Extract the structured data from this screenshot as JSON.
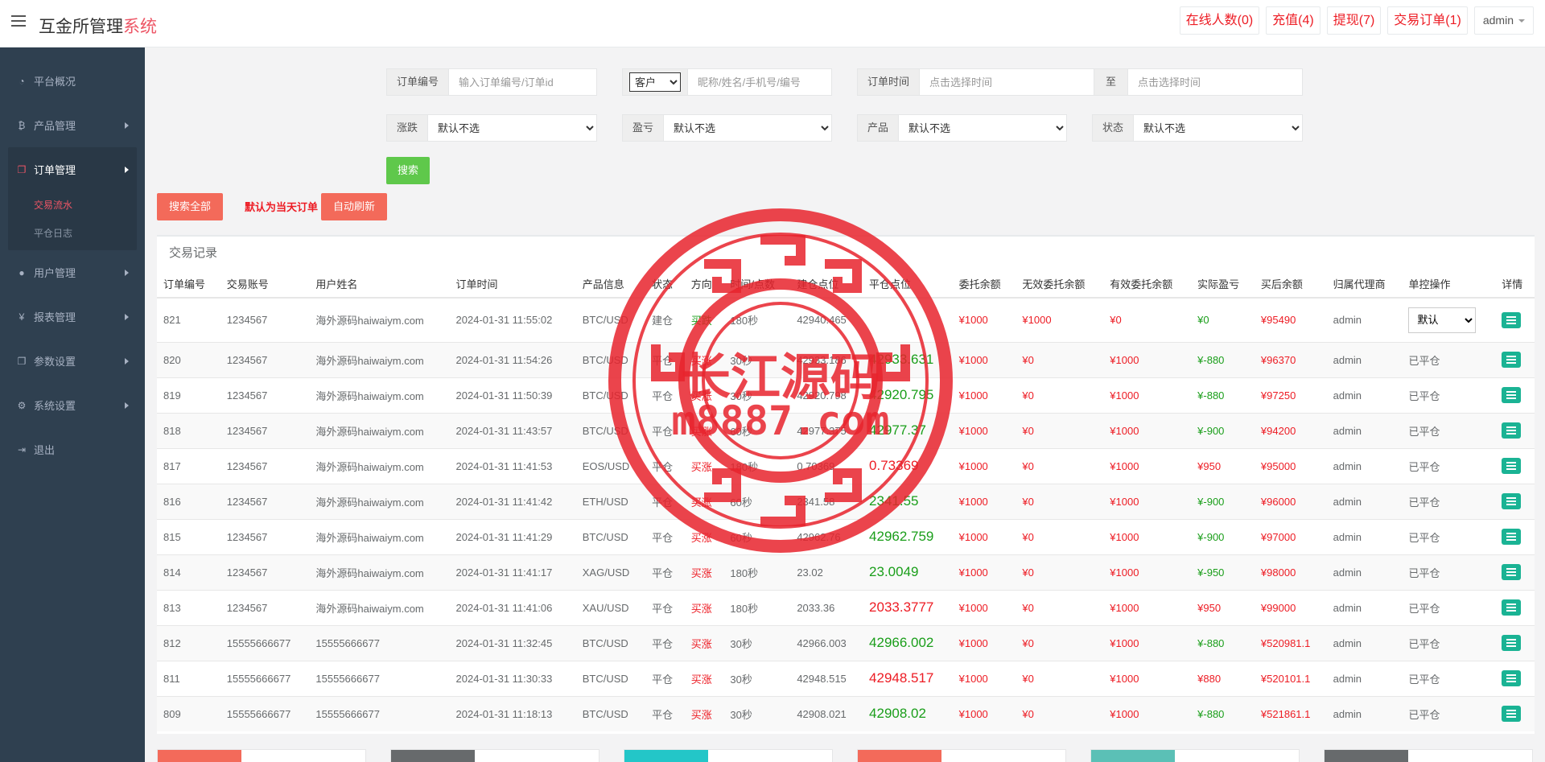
{
  "header": {
    "title_main": "互金所管理",
    "title_accent": "系统",
    "buttons": [
      "在线人数(0)",
      "充值(4)",
      "提现(7)",
      "交易订单(1)"
    ],
    "user": "admin"
  },
  "sidebar": {
    "items": [
      {
        "label": "平台概况",
        "icon": "dashboard-icon"
      },
      {
        "label": "产品管理",
        "icon": "bitcoin-icon"
      },
      {
        "label": "订单管理",
        "icon": "copy-icon"
      },
      {
        "label": "用户管理",
        "icon": "user-icon"
      },
      {
        "label": "报表管理",
        "icon": "yen-icon"
      },
      {
        "label": "参数设置",
        "icon": "copy-icon"
      },
      {
        "label": "系统设置",
        "icon": "cogs-icon"
      },
      {
        "label": "退出",
        "icon": "signout-icon"
      }
    ],
    "subitems": [
      "交易流水",
      "平仓日志"
    ]
  },
  "filters": {
    "order_no_label": "订单编号",
    "order_no_placeholder": "输入订单编号/订单id",
    "customer_select": "客户",
    "customer_placeholder": "昵称/姓名/手机号/编号",
    "order_time_label": "订单时间",
    "time_placeholder": "点击选择时间",
    "to_label": "至",
    "rise_label": "涨跌",
    "profit_label": "盈亏",
    "product_label": "产品",
    "status_label": "状态",
    "default_option": "默认不选",
    "search_btn": "搜索",
    "search_all_btn": "搜索全部",
    "default_note": "默认为当天订单",
    "auto_refresh_btn": "自动刷新"
  },
  "table": {
    "title": "交易记录",
    "columns": [
      "订单编号",
      "交易账号",
      "用户姓名",
      "订单时间",
      "产品信息",
      "状态",
      "方向",
      "时间/点数",
      "建仓点位",
      "平仓点位",
      "委托余额",
      "无效委托余额",
      "有效委托余额",
      "实际盈亏",
      "买后余额",
      "归属代理商",
      "单控操作",
      "详情"
    ],
    "rows": [
      {
        "id": "821",
        "account": "1234567",
        "name": "海外源码haiwaiym.com",
        "time": "2024-01-31 11:55:02",
        "product": "BTC/USD",
        "status": "建仓",
        "direction": "买跌",
        "dir_color": "green",
        "period": "180秒",
        "open": "42940.465",
        "close": "",
        "close_color": "",
        "entrust": "¥1000",
        "invalid": "¥1000",
        "valid": "¥0",
        "pnl": "¥0",
        "pnl_color": "green",
        "balance": "¥95490",
        "agent": "admin",
        "op": "默认",
        "op_select": true
      },
      {
        "id": "820",
        "account": "1234567",
        "name": "海外源码haiwaiym.com",
        "time": "2024-01-31 11:54:26",
        "product": "BTC/USD",
        "status": "平仓",
        "direction": "买涨",
        "dir_color": "red",
        "period": "30秒",
        "open": "42933.186",
        "close": "42933.631",
        "close_color": "green",
        "entrust": "¥1000",
        "invalid": "¥0",
        "valid": "¥1000",
        "pnl": "¥-880",
        "pnl_color": "green",
        "balance": "¥96370",
        "agent": "admin",
        "op": "已平仓",
        "op_select": false
      },
      {
        "id": "819",
        "account": "1234567",
        "name": "海外源码haiwaiym.com",
        "time": "2024-01-31 11:50:39",
        "product": "BTC/USD",
        "status": "平仓",
        "direction": "买涨",
        "dir_color": "red",
        "period": "30秒",
        "open": "42920.798",
        "close": "42920.795",
        "close_color": "green",
        "entrust": "¥1000",
        "invalid": "¥0",
        "valid": "¥1000",
        "pnl": "¥-880",
        "pnl_color": "green",
        "balance": "¥97250",
        "agent": "admin",
        "op": "已平仓",
        "op_select": false
      },
      {
        "id": "818",
        "account": "1234567",
        "name": "海外源码haiwaiym.com",
        "time": "2024-01-31 11:43:57",
        "product": "BTC/USD",
        "status": "平仓",
        "direction": "买涨",
        "dir_color": "red",
        "period": "60秒",
        "open": "42977.375",
        "close": "42977.37",
        "close_color": "green",
        "entrust": "¥1000",
        "invalid": "¥0",
        "valid": "¥1000",
        "pnl": "¥-900",
        "pnl_color": "green",
        "balance": "¥94200",
        "agent": "admin",
        "op": "已平仓",
        "op_select": false
      },
      {
        "id": "817",
        "account": "1234567",
        "name": "海外源码haiwaiym.com",
        "time": "2024-01-31 11:41:53",
        "product": "EOS/USD",
        "status": "平仓",
        "direction": "买涨",
        "dir_color": "red",
        "period": "180秒",
        "open": "0.70369",
        "close": "0.73369",
        "close_color": "red",
        "entrust": "¥1000",
        "invalid": "¥0",
        "valid": "¥1000",
        "pnl": "¥950",
        "pnl_color": "red",
        "balance": "¥95000",
        "agent": "admin",
        "op": "已平仓",
        "op_select": false
      },
      {
        "id": "816",
        "account": "1234567",
        "name": "海外源码haiwaiym.com",
        "time": "2024-01-31 11:41:42",
        "product": "ETH/USD",
        "status": "平仓",
        "direction": "买涨",
        "dir_color": "red",
        "period": "60秒",
        "open": "2341.58",
        "close": "2341.55",
        "close_color": "green",
        "entrust": "¥1000",
        "invalid": "¥0",
        "valid": "¥1000",
        "pnl": "¥-900",
        "pnl_color": "green",
        "balance": "¥96000",
        "agent": "admin",
        "op": "已平仓",
        "op_select": false
      },
      {
        "id": "815",
        "account": "1234567",
        "name": "海外源码haiwaiym.com",
        "time": "2024-01-31 11:41:29",
        "product": "BTC/USD",
        "status": "平仓",
        "direction": "买涨",
        "dir_color": "red",
        "period": "60秒",
        "open": "42962.76",
        "close": "42962.759",
        "close_color": "green",
        "entrust": "¥1000",
        "invalid": "¥0",
        "valid": "¥1000",
        "pnl": "¥-900",
        "pnl_color": "green",
        "balance": "¥97000",
        "agent": "admin",
        "op": "已平仓",
        "op_select": false
      },
      {
        "id": "814",
        "account": "1234567",
        "name": "海外源码haiwaiym.com",
        "time": "2024-01-31 11:41:17",
        "product": "XAG/USD",
        "status": "平仓",
        "direction": "买涨",
        "dir_color": "red",
        "period": "180秒",
        "open": "23.02",
        "close": "23.0049",
        "close_color": "green",
        "entrust": "¥1000",
        "invalid": "¥0",
        "valid": "¥1000",
        "pnl": "¥-950",
        "pnl_color": "green",
        "balance": "¥98000",
        "agent": "admin",
        "op": "已平仓",
        "op_select": false
      },
      {
        "id": "813",
        "account": "1234567",
        "name": "海外源码haiwaiym.com",
        "time": "2024-01-31 11:41:06",
        "product": "XAU/USD",
        "status": "平仓",
        "direction": "买涨",
        "dir_color": "red",
        "period": "180秒",
        "open": "2033.36",
        "close": "2033.3777",
        "close_color": "red",
        "entrust": "¥1000",
        "invalid": "¥0",
        "valid": "¥1000",
        "pnl": "¥950",
        "pnl_color": "red",
        "balance": "¥99000",
        "agent": "admin",
        "op": "已平仓",
        "op_select": false
      },
      {
        "id": "812",
        "account": "15555666677",
        "name": "15555666677",
        "time": "2024-01-31 11:32:45",
        "product": "BTC/USD",
        "status": "平仓",
        "direction": "买涨",
        "dir_color": "red",
        "period": "30秒",
        "open": "42966.003",
        "close": "42966.002",
        "close_color": "green",
        "entrust": "¥1000",
        "invalid": "¥0",
        "valid": "¥1000",
        "pnl": "¥-880",
        "pnl_color": "green",
        "balance": "¥520981.1",
        "agent": "admin",
        "op": "已平仓",
        "op_select": false
      },
      {
        "id": "811",
        "account": "15555666677",
        "name": "15555666677",
        "time": "2024-01-31 11:30:33",
        "product": "BTC/USD",
        "status": "平仓",
        "direction": "买涨",
        "dir_color": "red",
        "period": "30秒",
        "open": "42948.515",
        "close": "42948.517",
        "close_color": "red",
        "entrust": "¥1000",
        "invalid": "¥0",
        "valid": "¥1000",
        "pnl": "¥880",
        "pnl_color": "red",
        "balance": "¥520101.1",
        "agent": "admin",
        "op": "已平仓",
        "op_select": false
      },
      {
        "id": "809",
        "account": "15555666677",
        "name": "15555666677",
        "time": "2024-01-31 11:18:13",
        "product": "BTC/USD",
        "status": "平仓",
        "direction": "买涨",
        "dir_color": "red",
        "period": "30秒",
        "open": "42908.021",
        "close": "42908.02",
        "close_color": "green",
        "entrust": "¥1000",
        "invalid": "¥0",
        "valid": "¥1000",
        "pnl": "¥-880",
        "pnl_color": "green",
        "balance": "¥521861.1",
        "agent": "admin",
        "op": "已平仓",
        "op_select": false
      }
    ]
  },
  "summary": [
    {
      "label": "",
      "value": "",
      "color": "#f36a5a"
    },
    {
      "label": "",
      "value": "",
      "color": "#676a6c"
    },
    {
      "label": "",
      "value": "",
      "color": "#23c6c8"
    },
    {
      "label": "",
      "value": "",
      "color": "#f36a5a"
    },
    {
      "label": "",
      "value": "",
      "color": "#5bc0b6"
    },
    {
      "label": "",
      "value": "",
      "color": "#676a6c"
    }
  ],
  "watermark": {
    "line1": "长江源码",
    "line2": "m8887.com"
  },
  "colors": {
    "accent_red": "#ed1c24",
    "sidebar_bg": "#2f4050",
    "search_green": "#5fc84b",
    "button_red": "#f36a5a",
    "detail_teal": "#1ab394"
  }
}
